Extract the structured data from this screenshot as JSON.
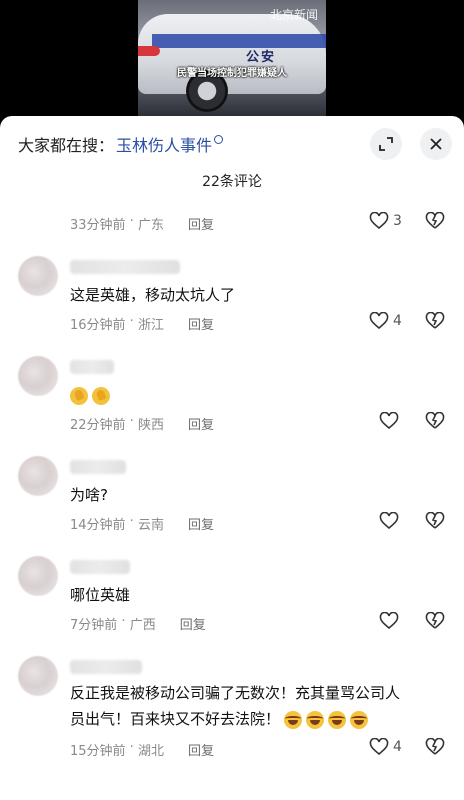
{
  "video": {
    "logo_text": "北京新闻",
    "car_text": "公安",
    "caption": "民警当场控制犯罪嫌疑人"
  },
  "header": {
    "search_prefix": "大家都在搜：",
    "search_term": "玉林伤人事件",
    "comment_count_title": "22条评论"
  },
  "comments": [
    {
      "text": "",
      "time": "33分钟前",
      "location": "广东",
      "reply": "回复",
      "likes": "3"
    },
    {
      "text": "这是英雄，移动太坑人了",
      "time": "16分钟前",
      "location": "浙江",
      "reply": "回复",
      "likes": "4"
    },
    {
      "text": "",
      "time": "22分钟前",
      "location": "陕西",
      "reply": "回复",
      "likes": ""
    },
    {
      "text": "为啥?",
      "time": "14分钟前",
      "location": "云南",
      "reply": "回复",
      "likes": ""
    },
    {
      "text": "哪位英雄",
      "time": "7分钟前",
      "location": "广西",
      "reply": "回复",
      "likes": ""
    },
    {
      "text_line1": "反正我是被移动公司骗了无数次！充其量骂公司人",
      "text_line2": "员出气！百来块又不好去法院！",
      "time": "15分钟前",
      "location": "湖北",
      "reply": "回复",
      "likes": "4"
    }
  ]
}
